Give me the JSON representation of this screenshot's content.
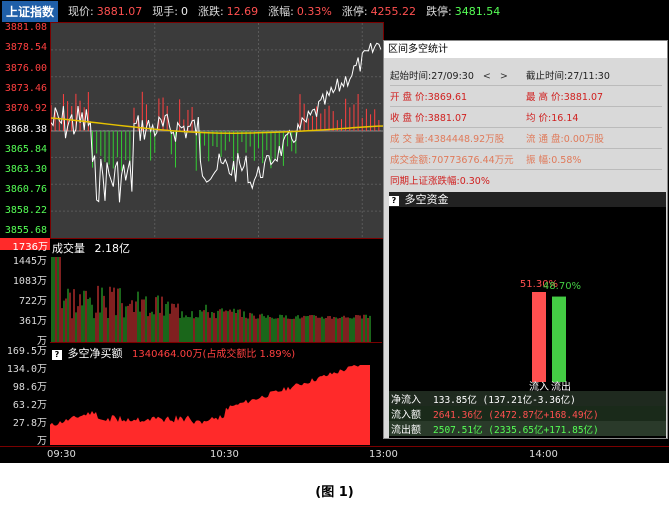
{
  "header": {
    "index_name": "上证指数",
    "price_label": "现价:",
    "price_value": "3881.07",
    "hand_label": "现手:",
    "hand_value": "0",
    "change_label": "涨跌:",
    "change_value": "12.69",
    "pct_label": "涨幅:",
    "pct_value": "0.33%",
    "limit_up_label": "涨停:",
    "limit_up_value": "4255.22",
    "limit_down_label": "跌停:",
    "limit_down_value": "3481.54"
  },
  "price_axis": {
    "ticks": [
      "3881.08",
      "3878.54",
      "3876.00",
      "3873.46",
      "3870.92",
      "3868.38",
      "3865.84",
      "3863.30",
      "3860.76",
      "3858.22",
      "3855.68"
    ],
    "tick_colors": [
      "#ff4040",
      "#ff4040",
      "#ff4040",
      "#ff4040",
      "#ff4040",
      "#ffffff",
      "#55ff55",
      "#55ff55",
      "#55ff55",
      "#55ff55",
      "#55ff55"
    ]
  },
  "volume": {
    "title": "成交量",
    "total": "2.18亿",
    "max_label": "1736万",
    "ticks": [
      "1445万",
      "1083万",
      "722万",
      "361万",
      "万"
    ]
  },
  "net": {
    "title": "多空净买额",
    "value_text": "1340464.00万(占成交额比 1.89%)",
    "ticks": [
      "169.5万",
      "134.0万",
      "98.6万",
      "63.2万",
      "27.8万",
      "万"
    ]
  },
  "xaxis": {
    "ticks": [
      "09:30",
      "10:30",
      "13:00",
      "14:00"
    ]
  },
  "stats": {
    "window_title": "区间多空统计",
    "start_label": "起始时间:",
    "start_value": "27/09:30",
    "end_label": "截止时间:",
    "end_value": "27/11:30",
    "open_label": "开 盘 价:",
    "open_value": "3869.61",
    "high_label": "最 高 价:",
    "high_value": "3881.07",
    "close_label": "收 盘 价:",
    "close_value": "3881.07",
    "avg_label": "均    价:",
    "avg_value": "16.14",
    "vol_label": "成 交 量:",
    "vol_value": "4384448.92万股",
    "float_label": "流 通 盘:",
    "float_value": "0.00万股",
    "amount_label": "成交金额:",
    "amount_value": "70773676.44万元",
    "amp_label": "振    幅:",
    "amp_value": "0.58%",
    "sync_label": "同期上证涨跌幅:",
    "sync_value": "0.30%"
  },
  "flow": {
    "title": "多空资金",
    "in_pct": "51.30%",
    "out_pct": "48.70%",
    "in_label": "流入",
    "out_label": "流出",
    "in_share": 0.513,
    "out_share": 0.487,
    "rows": [
      {
        "key": "净流入",
        "value": "133.85亿 (137.21亿-3.36亿)"
      },
      {
        "key": "流入额",
        "value": "2641.36亿 (2472.87亿+168.49亿)"
      },
      {
        "key": "流出额",
        "value": "2507.51亿 (2335.65亿+171.85亿)"
      }
    ]
  },
  "caption": "(图 1)",
  "colors": {
    "up": "#ff4040",
    "down": "#33cc33",
    "avg_line": "#e6c200",
    "price_line": "#ffffff",
    "net_fill": "#ff2a2a"
  }
}
